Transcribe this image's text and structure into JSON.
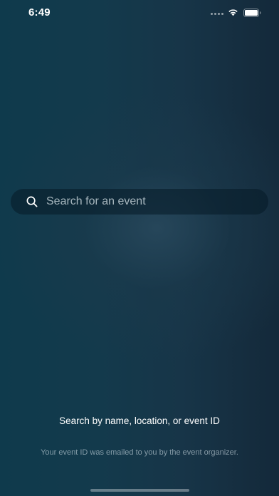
{
  "status_bar": {
    "time": "6:49",
    "wifi_icon": "wifi-icon",
    "battery_icon": "battery-icon"
  },
  "search": {
    "placeholder": "Search for an event",
    "value": "",
    "icon": "search-icon"
  },
  "hint": {
    "title": "Search by name, location, or event ID",
    "subtitle": "Your event ID was emailed to you by the event organizer."
  },
  "colors": {
    "background_left": "#0f3a4c",
    "background_right": "#14293a",
    "search_field": "#0b2331"
  }
}
